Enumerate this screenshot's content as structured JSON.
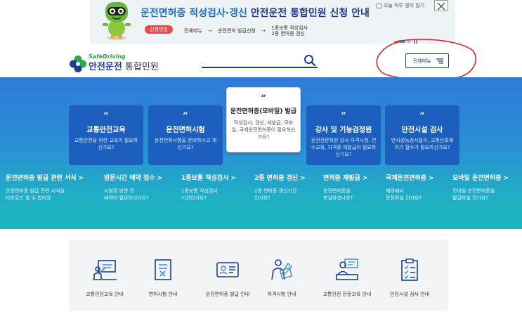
{
  "banner": {
    "title_part1": "운전면허증 적성검사·갱신",
    "title_part2": " 안전운전 통합민원 신청 안내",
    "badge": "신청방법",
    "step1": "전체메뉴",
    "step2": "운전면허 발급신청",
    "step3_line1": "1종보통 적성검사",
    "step3_line2": "2종 면허증 갱신",
    "no_show_today": "오늘 하루 열지 않기",
    "close_glyph": "✕"
  },
  "header": {
    "logo_en": "SafeDriving",
    "logo_ko_main": "안전운전",
    "logo_ko_sub": " 통합민원",
    "search_placeholder": "",
    "menu_label": "전체메뉴"
  },
  "cards": [
    {
      "quote": "“",
      "title": "교통안전교육",
      "desc": "교통안전을 위한 교육이 필요하신가요?"
    },
    {
      "quote": "“",
      "title": "운전면허시험",
      "desc": "운전면허시험을 준비하시고 계신가요?"
    },
    {
      "quote": "“",
      "title": "운전면허증(모바일) 발급",
      "desc": "적성검사, 갱신, 재발급, 모바일, 국제운전면허증이 필요하신가요?"
    },
    {
      "quote": "“",
      "title": "강사 및 기능검정원",
      "desc": "운전전문학원 강사 자격시험, 연수교육, 자격증 재발급이 필요하신가요?"
    },
    {
      "quote": "“",
      "title": "안전시설 검사",
      "desc": "반사성능검사접수, 교통신호제어기 접수가 필요하신가요?"
    }
  ],
  "quick_links": [
    {
      "title": "운전면허증 발급 관련 서식 >",
      "desc1": "운전면허증 발급 관련 서식을",
      "desc2": "다운로드 할 수 있어요"
    },
    {
      "title": "방문시간 예약 접수 >",
      "desc1": "시험장 방문 전",
      "desc2": "예약이 필요하신가요?"
    },
    {
      "title": "1종보통 적성검사 >",
      "desc1": "1종보통 적성검사",
      "desc2": "기간인가요?"
    },
    {
      "title": "2종 면허증 갱신 >",
      "desc1": "2종 면허증 갱신기간",
      "desc2": "인가요?"
    },
    {
      "title": "면허증 재발급 >",
      "desc1": "운전면허증을",
      "desc2": "분실하셨나요?"
    },
    {
      "title": "국제운전면허증 >",
      "desc1": "해외에서",
      "desc2": "운전하실 건가요?"
    },
    {
      "title": "모바일 운전면허증 >",
      "desc1": "모바일 운전면허증을",
      "desc2": "발급하실 건가요?"
    }
  ],
  "services": [
    {
      "label": "교통안전교육 안내",
      "icon": "presentation-icon"
    },
    {
      "label": "면허시험 안내",
      "icon": "exam-paper-icon"
    },
    {
      "label": "운전면허증 발급 안내",
      "icon": "license-card-icon"
    },
    {
      "label": "자격시험 안내",
      "icon": "person-writing-icon"
    },
    {
      "label": "교통안전 전문교육 안내",
      "icon": "lecture-icon"
    },
    {
      "label": "안전시설 검사 안내",
      "icon": "checklist-icon"
    }
  ],
  "colors": {
    "brand_navy": "#1b3f8f",
    "brand_green": "#2ba84a",
    "card_blue": "#1c5fbf",
    "annotation_red": "#d9262c"
  }
}
